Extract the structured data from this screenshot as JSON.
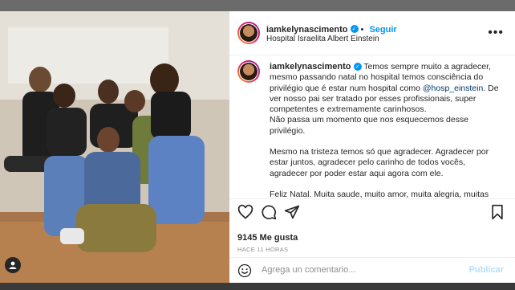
{
  "post": {
    "username": "iamkelynascimento",
    "follow_label": "Seguir",
    "location": "Hospital Israelita Albert Einstein",
    "more_icon": "more-horizontal-icon"
  },
  "caption": {
    "username": "iamkelynascimento",
    "part1_before_mention": "Temos sempre muito a agradecer, mesmo passando natal no hospital temos consciência do privilégio que é estar num hospital como ",
    "mention": "@hosp_einstein",
    "part1_after_mention": ". De ver nosso pai ser tratado por esses profissionais, super competentes e extremamente carinhosos.",
    "part1_line2": "Não passa um momento que nos esquecemos desse privilégio.",
    "part2": "Mesmo na tristeza temos só que agradecer. Agradecer por estar juntos, agradecer pelo carinho de todos vocês, agradecer por poder estar aqui agora com ele.",
    "part3": "Feliz Natal. Muita saude, muito amor, muita alegria, muitas"
  },
  "stats": {
    "likes_count": "9145",
    "likes_label": "Me gusta",
    "timestamp": "HACE 11 HORAS"
  },
  "comment": {
    "placeholder": "Agrega un comentario...",
    "publish_label": "Publicar"
  },
  "colors": {
    "accent": "#0095f6",
    "text": "#262626",
    "muted": "#8e8e8e",
    "publish_disabled": "#b2dffc"
  },
  "icons": [
    "heart-icon",
    "comment-icon",
    "share-icon",
    "bookmark-icon",
    "emoji-icon",
    "user-tag-icon",
    "verified-icon"
  ]
}
